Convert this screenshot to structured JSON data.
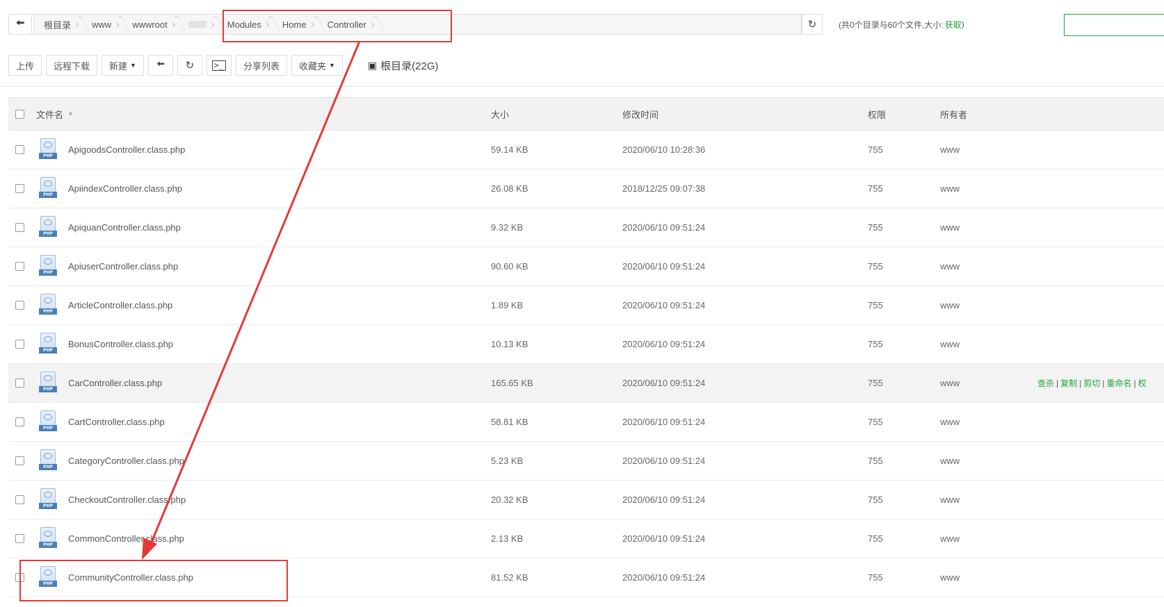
{
  "address_bar": {
    "crumbs": [
      "根目录",
      "www",
      "wwwroot",
      "",
      "Modules",
      "Home",
      "Controller"
    ],
    "dir_info_prefix": "(共0个目录与60个文件,大小:",
    "dir_info_link": "获取",
    "dir_info_suffix": ")"
  },
  "toolbar": {
    "upload": "上传",
    "remote_download": "远程下载",
    "new": "新建",
    "share_list": "分享列表",
    "favorites": "收藏夹",
    "root_disk": "根目录(22G)"
  },
  "table": {
    "headers": {
      "name": "文件名",
      "size": "大小",
      "mtime": "修改时间",
      "perm": "权限",
      "owner": "所有者"
    },
    "rows": [
      {
        "name": "ApigoodsController.class.php",
        "size": "59.14 KB",
        "mtime": "2020/06/10 10:28:36",
        "perm": "755",
        "owner": "www"
      },
      {
        "name": "ApiindexController.class.php",
        "size": "26.08 KB",
        "mtime": "2018/12/25 09:07:38",
        "perm": "755",
        "owner": "www"
      },
      {
        "name": "ApiquanController.class.php",
        "size": "9.32 KB",
        "mtime": "2020/06/10 09:51:24",
        "perm": "755",
        "owner": "www"
      },
      {
        "name": "ApiuserController.class.php",
        "size": "90.60 KB",
        "mtime": "2020/06/10 09:51:24",
        "perm": "755",
        "owner": "www"
      },
      {
        "name": "ArticleController.class.php",
        "size": "1.89 KB",
        "mtime": "2020/06/10 09:51:24",
        "perm": "755",
        "owner": "www"
      },
      {
        "name": "BonusController.class.php",
        "size": "10.13 KB",
        "mtime": "2020/06/10 09:51:24",
        "perm": "755",
        "owner": "www"
      },
      {
        "name": "CarController.class.php",
        "size": "165.65 KB",
        "mtime": "2020/06/10 09:51:24",
        "perm": "755",
        "owner": "www"
      },
      {
        "name": "CartController.class.php",
        "size": "58.81 KB",
        "mtime": "2020/06/10 09:51:24",
        "perm": "755",
        "owner": "www"
      },
      {
        "name": "CategoryController.class.php",
        "size": "5.23 KB",
        "mtime": "2020/06/10 09:51:24",
        "perm": "755",
        "owner": "www"
      },
      {
        "name": "CheckoutController.class.php",
        "size": "20.32 KB",
        "mtime": "2020/06/10 09:51:24",
        "perm": "755",
        "owner": "www"
      },
      {
        "name": "CommonController.class.php",
        "size": "2.13 KB",
        "mtime": "2020/06/10 09:51:24",
        "perm": "755",
        "owner": "www"
      },
      {
        "name": "CommunityController.class.php",
        "size": "81.52 KB",
        "mtime": "2020/06/10 09:51:24",
        "perm": "755",
        "owner": "www"
      }
    ],
    "row_ops": [
      "查杀",
      "复制",
      "剪切",
      "重命名",
      "权"
    ]
  },
  "colors": {
    "accent": "#20a53a",
    "annotation": "#e53935"
  },
  "icons": [
    "back-arrow-icon",
    "refresh-icon",
    "terminal-icon",
    "hdd-icon",
    "php-file-icon",
    "caret-down-icon"
  ]
}
